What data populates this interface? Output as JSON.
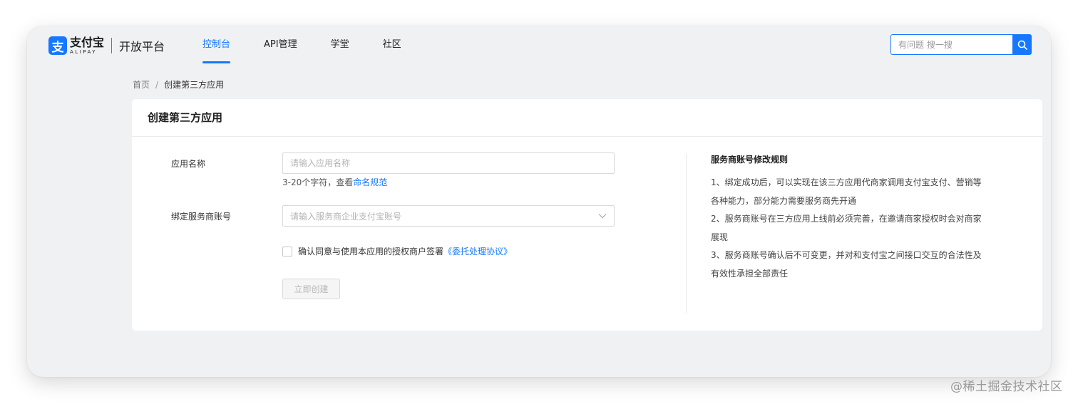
{
  "brand": {
    "logo_glyph": "支",
    "name_cn": "支付宝",
    "name_en": "ALIPAY",
    "platform": "开放平台",
    "color": "#1677ff"
  },
  "nav": {
    "items": [
      {
        "label": "控制台",
        "active": true
      },
      {
        "label": "API管理",
        "active": false
      },
      {
        "label": "学堂",
        "active": false
      },
      {
        "label": "社区",
        "active": false
      }
    ]
  },
  "search": {
    "placeholder": "有问题 搜一搜",
    "icon": "search-icon"
  },
  "breadcrumb": {
    "home": "首页",
    "separator": "/",
    "current": "创建第三方应用"
  },
  "form": {
    "title": "创建第三方应用",
    "app_name": {
      "label": "应用名称",
      "placeholder": "请输入应用名称",
      "hint_prefix": "3-20个字符，查看",
      "hint_link": "命名规范"
    },
    "provider_account": {
      "label": "绑定服务商账号",
      "placeholder": "请输入服务商企业支付宝账号",
      "icon": "chevron-down-icon"
    },
    "agreement": {
      "text": "确认同意与使用本应用的授权商户签署",
      "link": "《委托处理协议》"
    },
    "submit_label": "立即创建"
  },
  "rules": {
    "title": "服务商账号修改规则",
    "lines": [
      "1、绑定成功后，可以实现在该三方应用代商家调用支付宝支付、营销等",
      "各种能力，部分能力需要服务商先开通",
      "2、服务商账号在三方应用上线前必须完善，在邀请商家授权时会对商家",
      "展现",
      "3、服务商账号确认后不可变更，并对和支付宝之间接口交互的合法性及",
      "有效性承担全部责任"
    ]
  },
  "watermark": "@稀土掘金技术社区"
}
